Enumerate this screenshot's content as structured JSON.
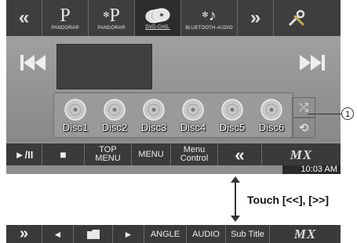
{
  "top_bar": {
    "left_arrow": "«",
    "sources": [
      {
        "big": "P",
        "label": "PANDORA®",
        "active": false
      },
      {
        "big": "P",
        "label": "PANDORA®",
        "active": false
      },
      {
        "big": "",
        "label": "DVD-CHG.",
        "active": true
      },
      {
        "big": "",
        "label": "BLUETOOTH-AUDIO",
        "active": false
      }
    ],
    "right_arrow": "»"
  },
  "player": {
    "prev_label": "⏮",
    "next_label": "⏭",
    "discs": [
      "Disc1",
      "Disc2",
      "Disc3",
      "Disc4",
      "Disc5",
      "Disc6"
    ],
    "shuffle_label": "⤮",
    "repeat_label": "⟲"
  },
  "bottom_bar": {
    "play_pause": "►/II",
    "stop": "■",
    "top_menu": "TOP\nMENU",
    "menu": "MENU",
    "menu_control": "Menu\nControl",
    "prev_page": "«",
    "logo": "MX"
  },
  "clock": "10:03 AM",
  "callout_number": "1",
  "touch_hint": "Touch [<<], [>>]",
  "alt_bar": {
    "next_page": "»",
    "prev": "◄",
    "folder": "",
    "play": "►",
    "angle": "ANGLE",
    "audio": "AUDIO",
    "subtitle": "Sub Title",
    "logo": "MX"
  },
  "colors": {
    "bar": "#3a3a3a",
    "screen": "#8f8f8f",
    "disc": "#c8c8c8"
  }
}
